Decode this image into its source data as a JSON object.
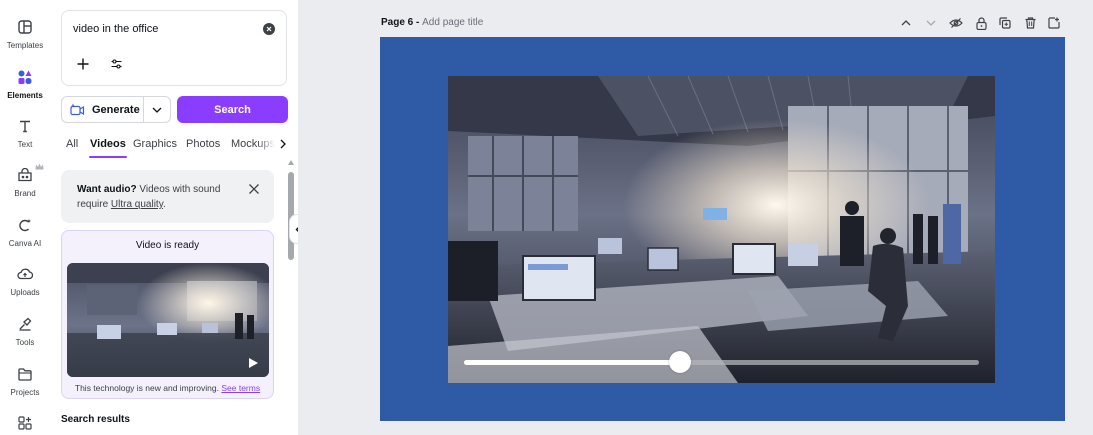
{
  "rail": {
    "items": [
      {
        "label": "Templates",
        "icon": "templates-icon"
      },
      {
        "label": "Elements",
        "icon": "elements-icon",
        "active": true
      },
      {
        "label": "Text",
        "icon": "text-icon"
      },
      {
        "label": "Brand",
        "icon": "brand-icon"
      },
      {
        "label": "Canva AI",
        "icon": "canva-ai-icon"
      },
      {
        "label": "Uploads",
        "icon": "uploads-icon"
      },
      {
        "label": "Tools",
        "icon": "tools-icon"
      },
      {
        "label": "Projects",
        "icon": "projects-icon"
      }
    ]
  },
  "panel": {
    "search_value": "video in the office",
    "generate_label": "Generate",
    "search_label": "Search",
    "tabs": [
      "All",
      "Videos",
      "Graphics",
      "Photos",
      "Mockups"
    ],
    "active_tab": "Videos",
    "audio_notice": {
      "bold": "Want audio?",
      "text": " Videos with sound require ",
      "link": "Ultra quality",
      "end": "."
    },
    "ready_card": {
      "title": "Video is ready",
      "note": "This technology is new and improving. ",
      "note_link": "See terms"
    },
    "results_title": "Search results"
  },
  "canvas": {
    "page_label": "Page 6 - ",
    "page_title_placeholder": "Add page title",
    "page_color": "#2e5aa6",
    "video_progress": 0.42
  },
  "colors": {
    "accent": "#8b3dff"
  }
}
